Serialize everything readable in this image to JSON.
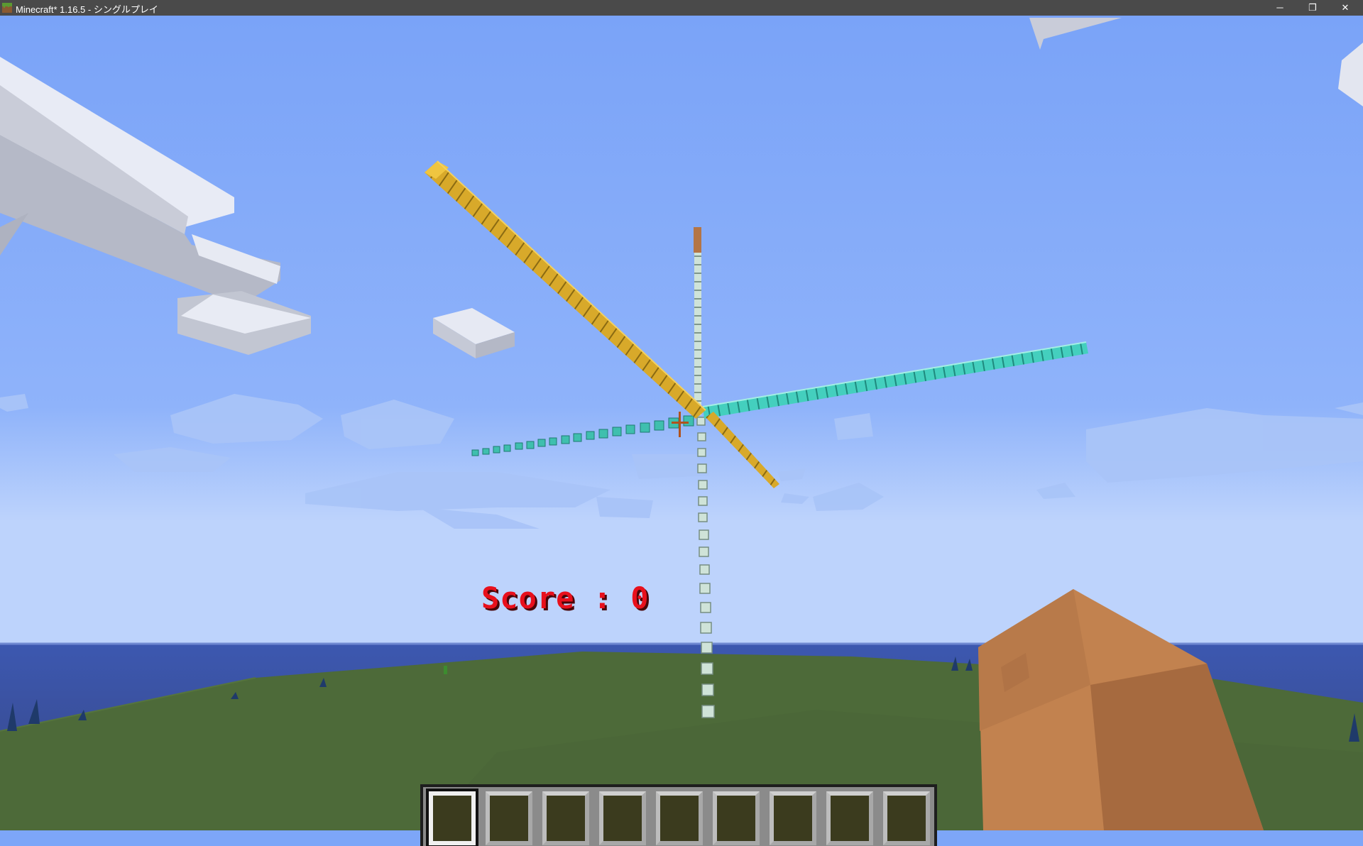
{
  "window": {
    "title": "Minecraft* 1.16.5 - シングルプレイ",
    "app_icon": "grass-block-icon",
    "buttons": [
      {
        "name": "minimize",
        "glyph": "─"
      },
      {
        "name": "restore",
        "glyph": "❐"
      },
      {
        "name": "close",
        "glyph": "✕"
      }
    ]
  },
  "hud": {
    "score_text": "Score : 0",
    "score_color": "#e8101c",
    "crosshair_icon": "crosshair-icon",
    "hotbar": {
      "slot_count": 9,
      "selected_slot": 1
    }
  },
  "scene": {
    "sky_color": "#7da6f8",
    "horizon_color": "#bcd2fb",
    "ocean_color": "#3d55a8",
    "grass_color": "#4f6b3a",
    "axes": [
      {
        "name": "gold-block-axis",
        "color": "#d4a62a"
      },
      {
        "name": "diamond-block-axis",
        "color": "#3cc4b4"
      },
      {
        "name": "quartz-block-axis",
        "color": "#c7dcd2"
      }
    ],
    "hand_color": "#c2824f"
  }
}
